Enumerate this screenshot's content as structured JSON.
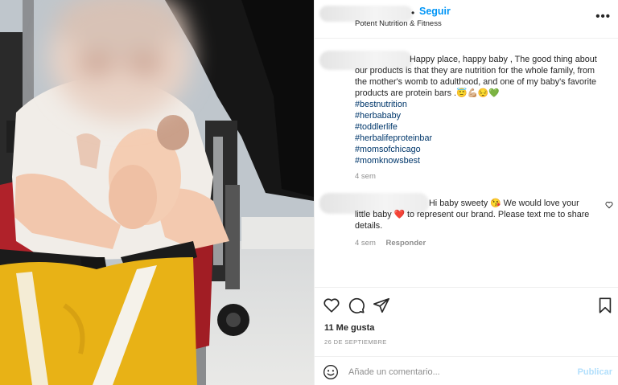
{
  "header": {
    "separator": "•",
    "follow_label": "Seguir",
    "subtitle": "Potent Nutrition & Fitness",
    "more_label": "•••"
  },
  "caption": {
    "text": "Happy place, happy baby , The good thing about our products is that they are nutrition for the whole family, from the mother's womb to adulthood, and one of my baby's favorite products are protein bars .😇💪🏼😔💚",
    "hashtags": [
      "#bestnutrition",
      "#herbababy",
      "#toddlerlife",
      "#herbalifeproteinbar",
      "#momsofchicago",
      "#momknowsbest"
    ],
    "time": "4 sem"
  },
  "reply_comment": {
    "text": "Hi baby sweety 😘 We would love your little baby ❤️ to represent our brand. Please text me to share details.",
    "time": "4 sem",
    "reply_label": "Responder"
  },
  "post": {
    "likes": "11 Me gusta",
    "date": "26 DE SEPTIEMBRE"
  },
  "composer": {
    "placeholder": "Añade un comentario...",
    "publish_label": "Publicar"
  },
  "icons": {
    "like": "heart-icon",
    "comment": "comment-icon",
    "share": "paper-plane-icon",
    "save": "bookmark-icon",
    "emoji": "smiley-icon",
    "comment_like": "small-heart-icon",
    "more": "more-icon"
  },
  "colors": {
    "link_blue": "#0095f6",
    "hashtag": "#00376b",
    "muted": "#8e8e8e",
    "publish_disabled": "#b2dffc"
  }
}
